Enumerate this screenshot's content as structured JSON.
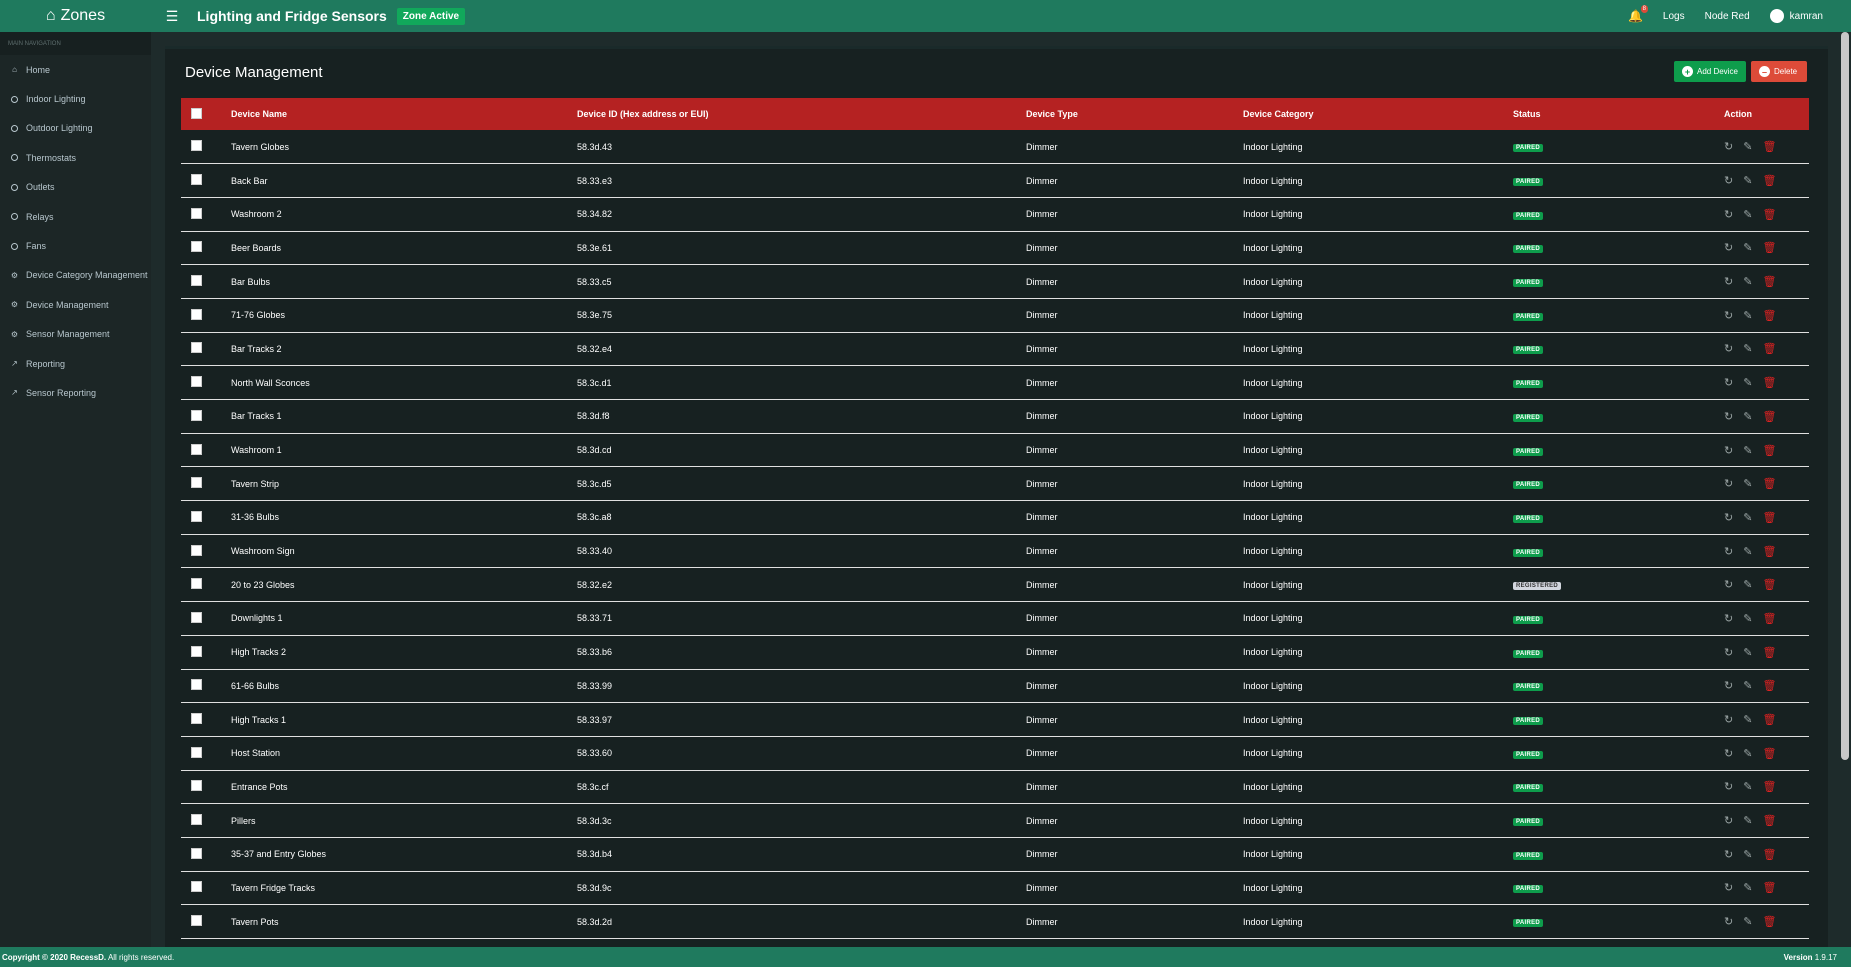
{
  "brand": {
    "name": "Zones"
  },
  "header": {
    "title": "Lighting and Fridge Sensors",
    "zone_status": "Zone Active",
    "notifications_count": "8",
    "links": {
      "logs": "Logs",
      "node_red": "Node Red"
    },
    "user": "kamran"
  },
  "sidebar": {
    "header": "MAIN NAVIGATION",
    "items": [
      {
        "label": "Home",
        "icon": "home-icon"
      },
      {
        "label": "Indoor Lighting",
        "icon": "circle-icon"
      },
      {
        "label": "Outdoor Lighting",
        "icon": "circle-icon"
      },
      {
        "label": "Thermostats",
        "icon": "circle-icon"
      },
      {
        "label": "Outlets",
        "icon": "circle-icon"
      },
      {
        "label": "Relays",
        "icon": "circle-icon"
      },
      {
        "label": "Fans",
        "icon": "circle-icon"
      },
      {
        "label": "Device Category Management",
        "icon": "gear-icon"
      },
      {
        "label": "Device Management",
        "icon": "gear-icon"
      },
      {
        "label": "Sensor Management",
        "icon": "gear-icon"
      },
      {
        "label": "Reporting",
        "icon": "line-chart-icon"
      },
      {
        "label": "Sensor Reporting",
        "icon": "line-chart-icon"
      }
    ]
  },
  "main": {
    "title": "Device Management",
    "add_label": "Add Device",
    "delete_label": "Delete",
    "columns": [
      "Device Name",
      "Device ID (Hex address or EUI)",
      "Device Type",
      "Device Category",
      "Status",
      "Action"
    ],
    "rows": [
      {
        "name": "Tavern Globes",
        "id": "58.3d.43",
        "type": "Dimmer",
        "category": "Indoor Lighting",
        "status": "PAIRED"
      },
      {
        "name": "Back Bar",
        "id": "58.33.e3",
        "type": "Dimmer",
        "category": "Indoor Lighting",
        "status": "PAIRED"
      },
      {
        "name": "Washroom 2",
        "id": "58.34.82",
        "type": "Dimmer",
        "category": "Indoor Lighting",
        "status": "PAIRED"
      },
      {
        "name": "Beer Boards",
        "id": "58.3e.61",
        "type": "Dimmer",
        "category": "Indoor Lighting",
        "status": "PAIRED"
      },
      {
        "name": "Bar Bulbs",
        "id": "58.33.c5",
        "type": "Dimmer",
        "category": "Indoor Lighting",
        "status": "PAIRED"
      },
      {
        "name": "71-76 Globes",
        "id": "58.3e.75",
        "type": "Dimmer",
        "category": "Indoor Lighting",
        "status": "PAIRED"
      },
      {
        "name": "Bar Tracks 2",
        "id": "58.32.e4",
        "type": "Dimmer",
        "category": "Indoor Lighting",
        "status": "PAIRED"
      },
      {
        "name": "North Wall Sconces",
        "id": "58.3c.d1",
        "type": "Dimmer",
        "category": "Indoor Lighting",
        "status": "PAIRED"
      },
      {
        "name": "Bar Tracks 1",
        "id": "58.3d.f8",
        "type": "Dimmer",
        "category": "Indoor Lighting",
        "status": "PAIRED"
      },
      {
        "name": "Washroom 1",
        "id": "58.3d.cd",
        "type": "Dimmer",
        "category": "Indoor Lighting",
        "status": "PAIRED"
      },
      {
        "name": "Tavern Strip",
        "id": "58.3c.d5",
        "type": "Dimmer",
        "category": "Indoor Lighting",
        "status": "PAIRED"
      },
      {
        "name": "31-36 Bulbs",
        "id": "58.3c.a8",
        "type": "Dimmer",
        "category": "Indoor Lighting",
        "status": "PAIRED"
      },
      {
        "name": "Washroom Sign",
        "id": "58.33.40",
        "type": "Dimmer",
        "category": "Indoor Lighting",
        "status": "PAIRED"
      },
      {
        "name": "20 to 23 Globes",
        "id": "58.32.e2",
        "type": "Dimmer",
        "category": "Indoor Lighting",
        "status": "REGISTERED"
      },
      {
        "name": "Downlights 1",
        "id": "58.33.71",
        "type": "Dimmer",
        "category": "Indoor Lighting",
        "status": "PAIRED"
      },
      {
        "name": "High Tracks 2",
        "id": "58.33.b6",
        "type": "Dimmer",
        "category": "Indoor Lighting",
        "status": "PAIRED"
      },
      {
        "name": "61-66 Bulbs",
        "id": "58.33.99",
        "type": "Dimmer",
        "category": "Indoor Lighting",
        "status": "PAIRED"
      },
      {
        "name": "High Tracks 1",
        "id": "58.33.97",
        "type": "Dimmer",
        "category": "Indoor Lighting",
        "status": "PAIRED"
      },
      {
        "name": "Host Station",
        "id": "58.33.60",
        "type": "Dimmer",
        "category": "Indoor Lighting",
        "status": "PAIRED"
      },
      {
        "name": "Entrance Pots",
        "id": "58.3c.cf",
        "type": "Dimmer",
        "category": "Indoor Lighting",
        "status": "PAIRED"
      },
      {
        "name": "Pillers",
        "id": "58.3d.3c",
        "type": "Dimmer",
        "category": "Indoor Lighting",
        "status": "PAIRED"
      },
      {
        "name": "35-37 and Entry Globes",
        "id": "58.3d.b4",
        "type": "Dimmer",
        "category": "Indoor Lighting",
        "status": "PAIRED"
      },
      {
        "name": "Tavern Fridge Tracks",
        "id": "58.3d.9c",
        "type": "Dimmer",
        "category": "Indoor Lighting",
        "status": "PAIRED"
      },
      {
        "name": "Tavern Pots",
        "id": "58.3d.2d",
        "type": "Dimmer",
        "category": "Indoor Lighting",
        "status": "PAIRED"
      }
    ]
  },
  "footer": {
    "copyright_bold": "Copyright © 2020 RecessD.",
    "copyright_rest": " All rights reserved.",
    "version_label": "Version",
    "version_value": " 1.9.17"
  },
  "colors": {
    "header": "#1f7a5e",
    "table_header": "#b52222",
    "paired": "#0e9d4c",
    "delete": "#dd4b39"
  }
}
